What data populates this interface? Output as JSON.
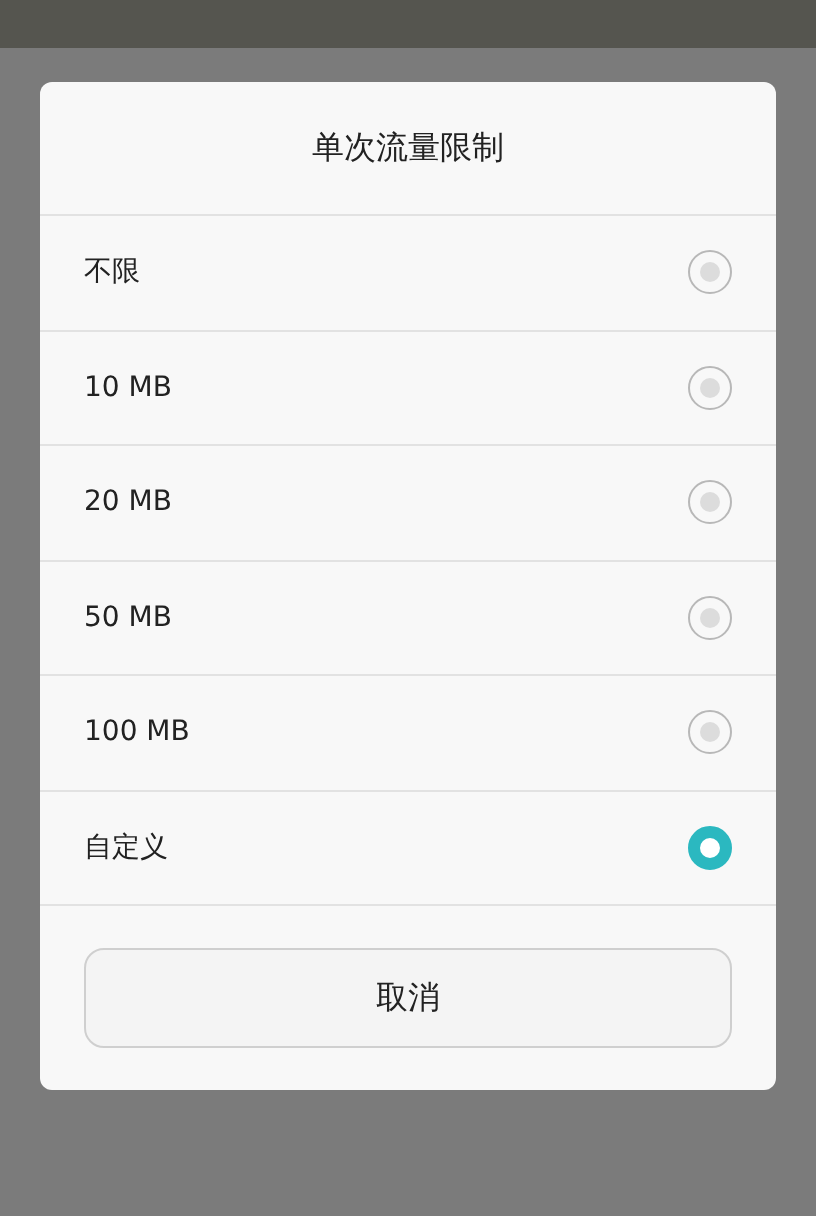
{
  "dialog": {
    "title": "单次流量限制",
    "options": [
      {
        "label": "不限",
        "selected": false
      },
      {
        "label": "10 MB",
        "selected": false
      },
      {
        "label": "20 MB",
        "selected": false
      },
      {
        "label": "50 MB",
        "selected": false
      },
      {
        "label": "100 MB",
        "selected": false
      },
      {
        "label": "自定义",
        "selected": true
      }
    ],
    "cancel_button": "取消"
  }
}
